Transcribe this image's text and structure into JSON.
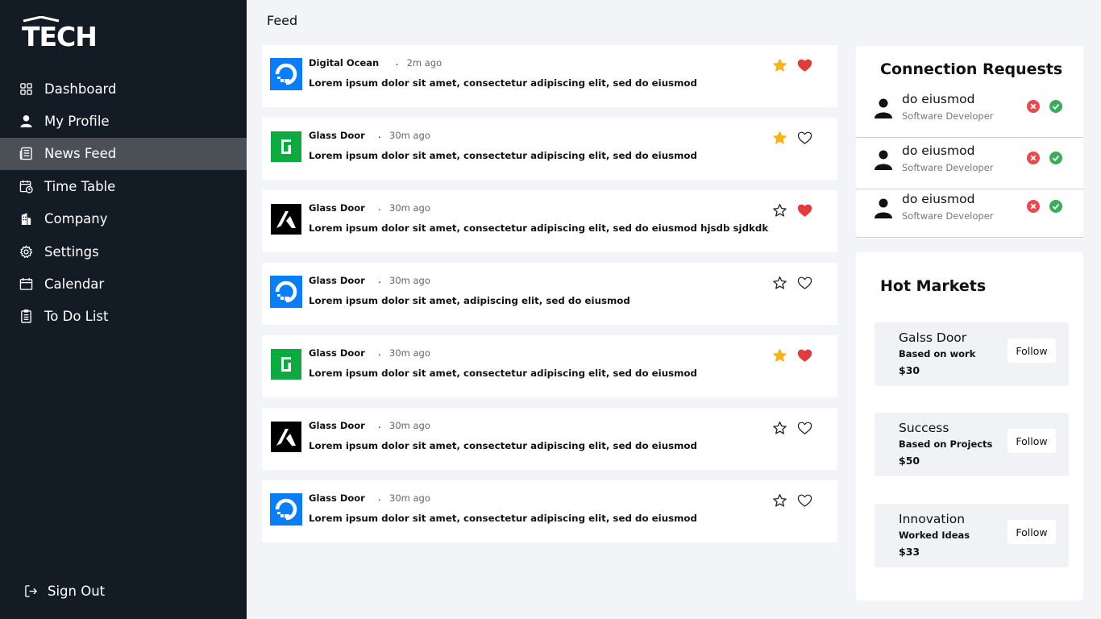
{
  "brand": {
    "logo_text": "TECH"
  },
  "sidebar": {
    "items": [
      {
        "label": "Dashboard",
        "icon": "dashboard-grid-icon"
      },
      {
        "label": "My Profile",
        "icon": "user-icon"
      },
      {
        "label": "News Feed",
        "icon": "newspaper-icon",
        "active": true
      },
      {
        "label": "Time Table",
        "icon": "timetable-icon"
      },
      {
        "label": "Company",
        "icon": "building-icon"
      },
      {
        "label": "Settings",
        "icon": "gear-icon"
      },
      {
        "label": "Calendar",
        "icon": "calendar-icon"
      },
      {
        "label": "To Do List",
        "icon": "checklist-icon"
      }
    ],
    "sign_out": "Sign Out"
  },
  "header": {
    "title": "Feed"
  },
  "feed": {
    "posts": [
      {
        "source": "Digital Ocean",
        "time": "2m ago",
        "text": "Lorem ipsum dolor sit amet, consectetur adipiscing elit, sed do eiusmod",
        "logo": "digitalocean-logo",
        "starred": true,
        "liked": true
      },
      {
        "source": "Glass Door",
        "time": "30m ago",
        "text": "Lorem ipsum dolor sit amet, consectetur adipiscing elit, sed do eiusmod",
        "logo": "glassdoor-logo",
        "starred": true,
        "liked": false
      },
      {
        "source": "Glass Door",
        "time": "30m ago",
        "text": "Lorem ipsum dolor sit amet, consectetur adipiscing elit, sed do eiusmod hjsdb sjdkdk",
        "logo": "k-logo",
        "starred": false,
        "liked": true
      },
      {
        "source": "Glass Door",
        "time": "30m ago",
        "text": "Lorem ipsum dolor sit amet, adipiscing elit, sed do eiusmod",
        "logo": "digitalocean-logo",
        "starred": false,
        "liked": false
      },
      {
        "source": "Glass Door",
        "time": "30m ago",
        "text": "Lorem ipsum dolor sit amet, consectetur adipiscing elit, sed do eiusmod",
        "logo": "glassdoor-logo",
        "starred": true,
        "liked": true
      },
      {
        "source": "Glass Door",
        "time": "30m ago",
        "text": "Lorem ipsum dolor sit amet, consectetur adipiscing elit, sed do eiusmod",
        "logo": "k-logo",
        "starred": false,
        "liked": false
      },
      {
        "source": "Glass Door",
        "time": "30m ago",
        "text": "Lorem ipsum dolor sit amet, consectetur adipiscing elit, sed do eiusmod",
        "logo": "digitalocean-logo",
        "starred": false,
        "liked": false
      }
    ],
    "separator": "."
  },
  "connections": {
    "title": "Connection Requests",
    "requests": [
      {
        "name": "do eiusmod",
        "role": "Software Developer"
      },
      {
        "name": "do eiusmod",
        "role": "Software Developer"
      },
      {
        "name": "do eiusmod",
        "role": "Software Developer"
      }
    ]
  },
  "markets": {
    "title": "Hot Markets",
    "follow_label": "Follow",
    "items": [
      {
        "name": "Galss Door",
        "subtitle": "Based on work",
        "price": "$30"
      },
      {
        "name": "Success",
        "subtitle": "Based on Projects",
        "price": "$50"
      },
      {
        "name": "Innovation",
        "subtitle": "Worked Ideas",
        "price": "$33"
      }
    ]
  },
  "colors": {
    "sidebar_bg": "#131c24",
    "active_nav": "#4a5056",
    "star_gold": "#f5b41a",
    "heart_red": "#e03c3c",
    "accept_green": "#3aac5a",
    "reject_red": "#e8494d",
    "digitalocean_blue": "#0a7ef7",
    "glassdoor_green": "#0caa41"
  }
}
